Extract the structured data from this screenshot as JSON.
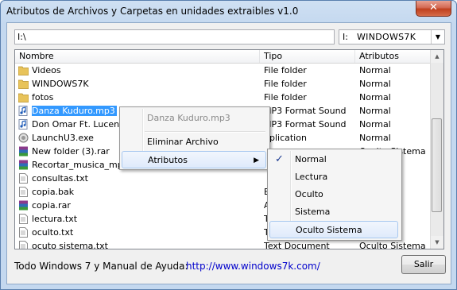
{
  "window": {
    "title": "Atributos de Archivos y Carpetas en unidades extraibles v1.0",
    "close_label": "✕"
  },
  "path_input": {
    "value": "I:\\"
  },
  "drive_select": {
    "letter": "I:",
    "name": "WINDOWS7K",
    "arrow": "▼"
  },
  "list": {
    "columns": [
      "Nombre",
      "Tipo",
      "Atributos"
    ],
    "rows": [
      {
        "name": "Videos",
        "type": "File folder",
        "attr": "Normal",
        "icon": "folder-icon"
      },
      {
        "name": "WINDOWS7K",
        "type": "File folder",
        "attr": "Normal",
        "icon": "folder-icon"
      },
      {
        "name": "fotos",
        "type": "File folder",
        "attr": "Normal",
        "icon": "folder-icon"
      },
      {
        "name": "Danza Kuduro.mp3",
        "type": "MP3 Format Sound",
        "attr": "Normal",
        "icon": "music-file-icon"
      },
      {
        "name": "Don Omar Ft. Lucenzo",
        "type": "MP3 Format Sound",
        "attr": "Normal",
        "icon": "music-file-icon"
      },
      {
        "name": "LaunchU3.exe",
        "type": "pplication",
        "attr": "Normal",
        "icon": "exe-icon"
      },
      {
        "name": "New folder (3).rar",
        "type": "",
        "attr": "Oculto Sistema",
        "icon": "rar-icon"
      },
      {
        "name": "Recortar_musica_mpTr",
        "type": "",
        "attr": "",
        "icon": "rar-icon"
      },
      {
        "name": "consultas.txt",
        "type": "",
        "attr": "",
        "icon": "text-file-icon"
      },
      {
        "name": "copia.bak",
        "type": "E",
        "attr": "",
        "icon": "file-icon"
      },
      {
        "name": "copia.rar",
        "type": "A",
        "attr": "",
        "icon": "rar-icon"
      },
      {
        "name": "lectura.txt",
        "type": "T",
        "attr": "",
        "icon": "text-file-icon"
      },
      {
        "name": "oculto.txt",
        "type": "T",
        "attr": "",
        "icon": "text-file-icon"
      },
      {
        "name": "ocuto sistema.txt",
        "type": "Text Document",
        "attr": "Oculto Sistema",
        "icon": "text-file-icon"
      }
    ]
  },
  "footer": {
    "text": "Todo Windows 7 y Manual de Ayuda:",
    "link": "http://www.windows7k.com/",
    "exit_label": "Salir"
  },
  "context_menu": {
    "header": "Danza Kuduro.mp3",
    "delete_label": "Eliminar Archivo",
    "attributes_label": "Atributos",
    "arrow": "▶"
  },
  "attributes_submenu": {
    "items": [
      "Normal",
      "Lectura",
      "Oculto",
      "Sistema",
      "Oculto Sistema"
    ],
    "checked": "Normal",
    "check_glyph": "✓"
  },
  "scrollbar": {
    "up": "▲",
    "down": "▼"
  }
}
